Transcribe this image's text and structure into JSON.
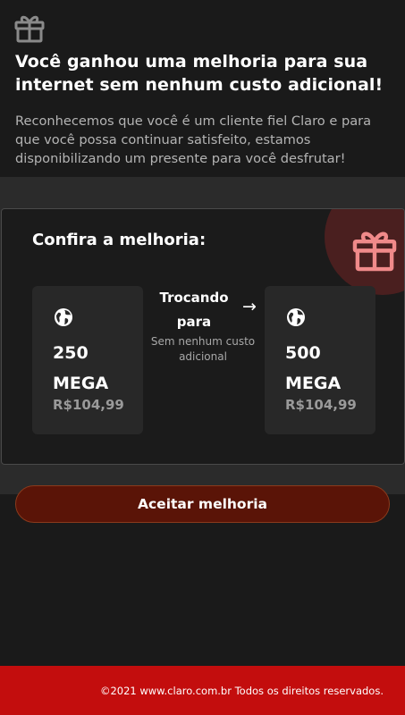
{
  "header": {
    "icon": "gift-icon",
    "headline": "Você ganhou uma melhoria para sua internet sem nenhum custo adicional!",
    "intro": "Reconhecemos que você é um cliente fiel Claro e para que você possa continuar satisfeito, estamos disponibilizando um presente para você desfrutar!"
  },
  "card": {
    "title": "Confira a melhoria:",
    "badge_icon": "gift-icon",
    "current_plan": {
      "icon": "globe-icon",
      "speed_value": "250",
      "speed_unit": "MEGA",
      "price": "R$104,99"
    },
    "swap": {
      "label_line1": "Trocando",
      "label_line2": "para",
      "arrow": "→",
      "subtext": "Sem nenhum custo adicional"
    },
    "new_plan": {
      "icon": "globe-icon",
      "speed_value": "500",
      "speed_unit": "MEGA",
      "price": "R$104,99"
    }
  },
  "actions": {
    "accept_label": "Aceitar melhoria"
  },
  "footer": {
    "text": "©2021 www.claro.com.br Todos os direitos reservados."
  },
  "colors": {
    "background": "#1a1a1a",
    "accent_red": "#c30d0d",
    "button_bg": "#5a1407",
    "gift_pink": "#f08a8a"
  }
}
